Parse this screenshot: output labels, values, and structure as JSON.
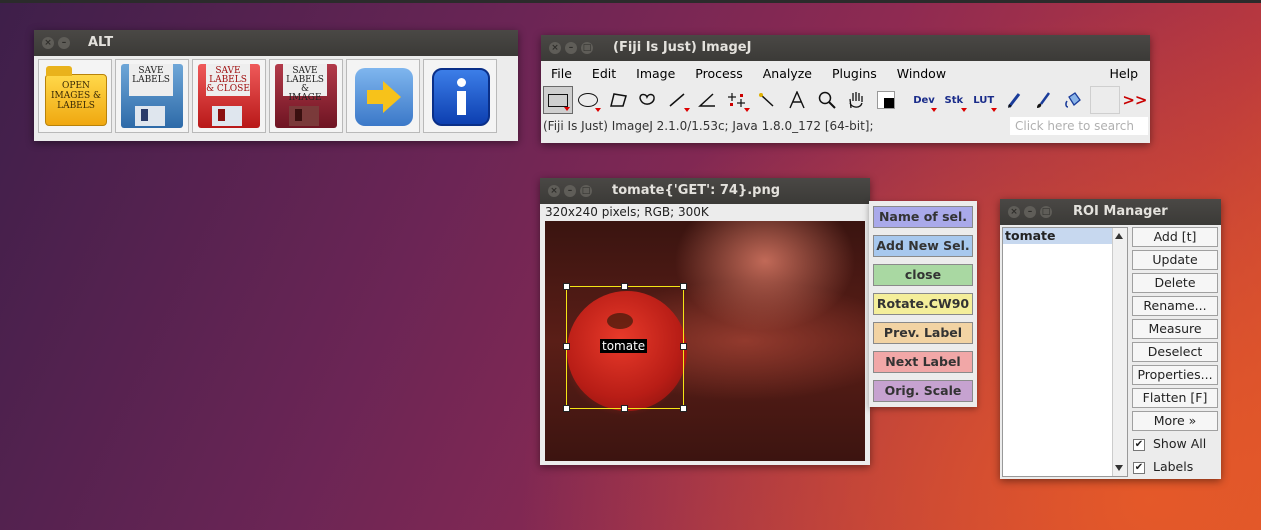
{
  "alt": {
    "title": "ALT",
    "buttons": [
      {
        "lines": [
          "OPEN",
          "IMAGES &",
          "LABELS"
        ]
      },
      {
        "lines": [
          "SAVE",
          "LABELS"
        ]
      },
      {
        "lines": [
          "SAVE",
          "LABELS",
          "& CLOSE"
        ]
      },
      {
        "lines": [
          "SAVE",
          "LABELS &",
          "IMAGE"
        ]
      }
    ]
  },
  "imagej": {
    "title": "(Fiji Is Just) ImageJ",
    "menu": [
      "File",
      "Edit",
      "Image",
      "Process",
      "Analyze",
      "Plugins",
      "Window",
      "Help"
    ],
    "tools": {
      "dev": "Dev",
      "stk": "Stk",
      "lut": "LUT"
    },
    "status": "(Fiji Is Just) ImageJ 2.1.0/1.53c; Java 1.8.0_172 [64-bit];",
    "search_placeholder": "Click here to search"
  },
  "image_window": {
    "title": "tomate{'GET': 74}.png",
    "info": "320x240 pixels; RGB; 300K",
    "roi_label": "tomate"
  },
  "side_buttons": [
    {
      "label": "Name of sel.",
      "color": "#a9a9ea"
    },
    {
      "label": "Add New Sel.",
      "color": "#a7c8ee"
    },
    {
      "label": "close",
      "color": "#a9d8a2"
    },
    {
      "label": "Rotate.CW90",
      "color": "#f4ee9a"
    },
    {
      "label": "Prev. Label",
      "color": "#f2d3a3"
    },
    {
      "label": "Next Label",
      "color": "#f1a7a7"
    },
    {
      "label": "Orig. Scale",
      "color": "#c6a2d0"
    }
  ],
  "roi_manager": {
    "title": "ROI Manager",
    "items": [
      "tomate"
    ],
    "buttons": [
      "Add [t]",
      "Update",
      "Delete",
      "Rename...",
      "Measure",
      "Deselect",
      "Properties...",
      "Flatten [F]",
      "More »"
    ],
    "checkboxes": [
      {
        "label": "Show All",
        "checked": true
      },
      {
        "label": "Labels",
        "checked": true
      }
    ]
  }
}
